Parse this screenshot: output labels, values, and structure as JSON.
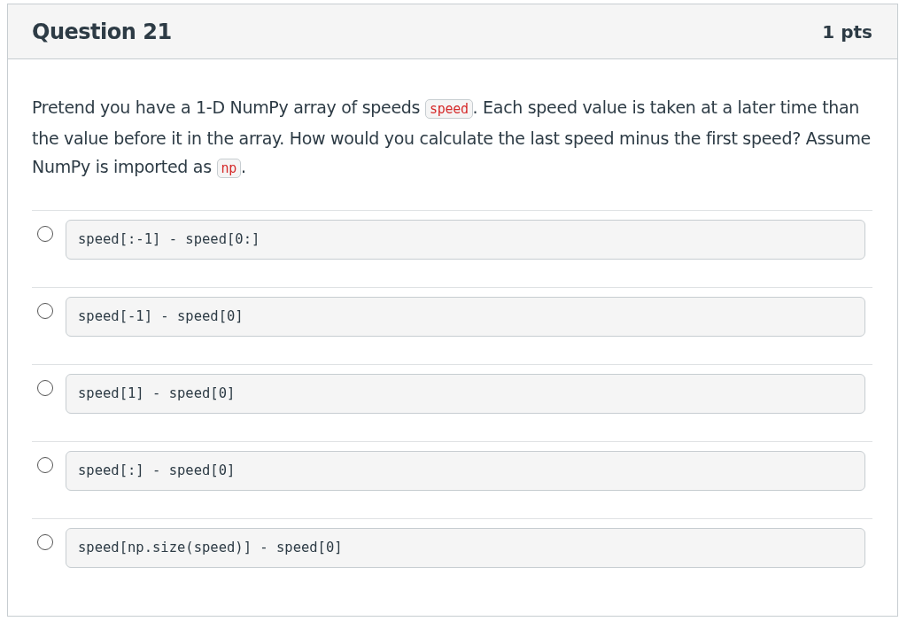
{
  "question": {
    "title": "Question 21",
    "points": "1 pts"
  },
  "prompt": [
    {
      "kind": "text",
      "text": "Pretend you have a 1-D NumPy array of speeds "
    },
    {
      "kind": "code",
      "text": "speed"
    },
    {
      "kind": "text",
      "text": ". Each speed value is taken at a later time than the value before it in the array. How would you calculate the last speed minus the first speed? Assume NumPy is imported as "
    },
    {
      "kind": "code",
      "text": "np"
    },
    {
      "kind": "text",
      "text": "."
    }
  ],
  "answers": [
    {
      "text": "speed[:-1] - speed[0:]",
      "selected": false
    },
    {
      "text": "speed[-1] - speed[0]",
      "selected": false
    },
    {
      "text": "speed[1] - speed[0]",
      "selected": false
    },
    {
      "text": "speed[:] - speed[0]",
      "selected": false
    },
    {
      "text": "speed[np.size(speed)] - speed[0]",
      "selected": false
    }
  ]
}
